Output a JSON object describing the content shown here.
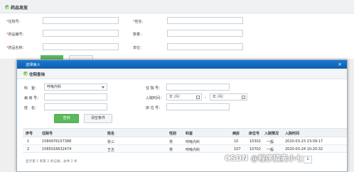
{
  "background": {
    "title": "药品发放",
    "fields": [
      {
        "label": "住院号：",
        "required": true
      },
      {
        "label": "姓名：",
        "required": true
      },
      {
        "label": "药品编号：",
        "required": true
      },
      {
        "label": "数量：",
        "required": false
      },
      {
        "label": "药品名称：",
        "required": true
      },
      {
        "label": "单位：",
        "required": false
      }
    ]
  },
  "modal": {
    "title": "选择病人",
    "close_icon": "×",
    "section_title": "住院查询",
    "form": {
      "department_label": "科　室：",
      "department_value": "呼吸内科",
      "admission_no_label": "住 院 号：",
      "ward_label": "病 房 号：",
      "admit_time_label": "入院时间：",
      "date_from_placeholder": "年 /月/",
      "date_to_placeholder": "年 /月/",
      "date_separator": "-",
      "name_label": "姓　名：",
      "bed_label": "床 位 号："
    },
    "buttons": {
      "search": "查询",
      "clear": "清空条件"
    },
    "table": {
      "headers": [
        "序号",
        "住院号",
        "姓名",
        "性别",
        "科室",
        "病房",
        "床位号",
        "入院情况",
        "入院时间"
      ],
      "rows": [
        [
          "1",
          "1584976157388",
          "张三",
          "男",
          "呼吸内科",
          "10",
          "10302",
          "一般",
          "2020-03-23 23:09:17"
        ],
        [
          "2",
          "1585016632474",
          "王五",
          "男",
          "呼吸内科",
          "107",
          "10702",
          "一般",
          "2020-03-24 10:20:32"
        ]
      ]
    },
    "pager_text": "显示第 1 到第 2 条记录，总共 2 条",
    "current_page": "1"
  },
  "watermark": "CSDN @程序猿麦小七",
  "colors": {
    "modal_header": "#0c5eae",
    "search_button": "#5cb85c",
    "accent_green": "#7cc04a"
  }
}
